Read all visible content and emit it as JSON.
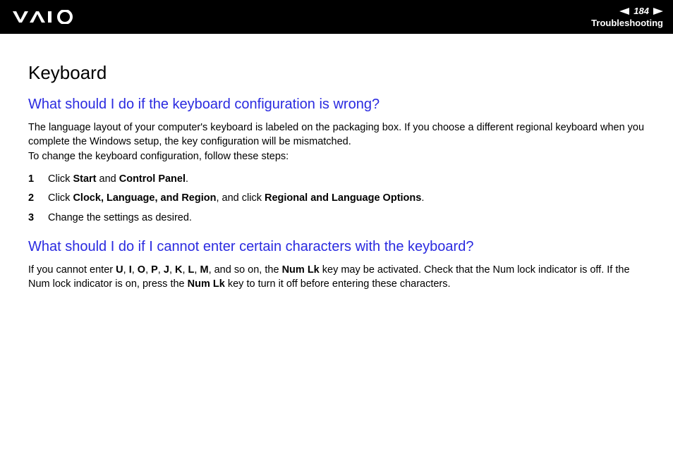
{
  "header": {
    "page_number": "184",
    "section": "Troubleshooting"
  },
  "content": {
    "title": "Keyboard",
    "q1": {
      "heading": "What should I do if the keyboard configuration is wrong?",
      "para1": "The language layout of your computer's keyboard is labeled on the packaging box. If you choose a different regional keyboard when you complete the Windows setup, the key configuration will be mismatched.",
      "para2": "To change the keyboard configuration, follow these steps:",
      "steps": [
        {
          "pre": "Click ",
          "b1": "Start",
          "mid1": " and ",
          "b2": "Control Panel",
          "post": "."
        },
        {
          "pre": "Click ",
          "b1": "Clock, Language, and Region",
          "mid1": ", and click ",
          "b2": "Regional and Language Options",
          "post": "."
        },
        {
          "pre": "Change the settings as desired."
        }
      ]
    },
    "q2": {
      "heading": "What should I do if I cannot enter certain characters with the keyboard?",
      "para_pre": "If you cannot enter ",
      "c1": "U",
      "s1": ", ",
      "c2": "I",
      "s2": ", ",
      "c3": "O",
      "s3": ", ",
      "c4": "P",
      "s4": ", ",
      "c5": "J",
      "s5": ", ",
      "c6": "K",
      "s6": ", ",
      "c7": "L",
      "s7": ", ",
      "c8": "M",
      "para_mid1": ", and so on, the ",
      "numlk1": "Num Lk",
      "para_mid2": " key may be activated. Check that the Num lock indicator is off. If the Num lock indicator is on, press the ",
      "numlk2": "Num Lk",
      "para_post": " key to turn it off before entering these characters."
    }
  }
}
